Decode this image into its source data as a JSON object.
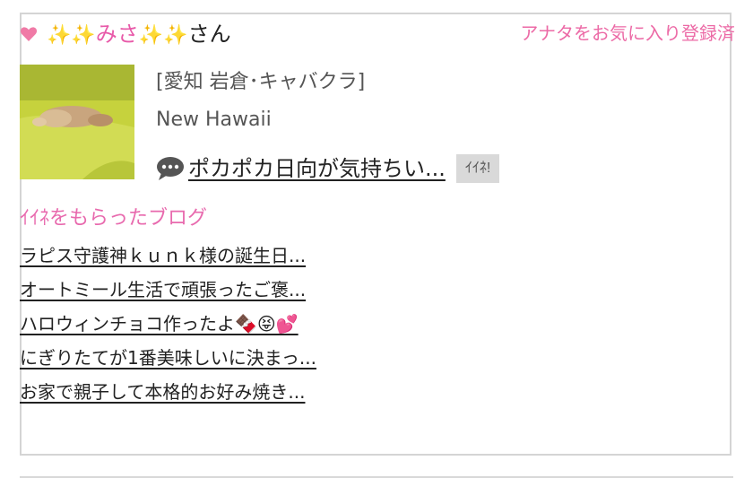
{
  "profile": {
    "name_prefix": "✨✨",
    "name_core": "みさ",
    "name_suffix_sparkles": "✨✨",
    "honorific": "さん",
    "favorite_status": "アナタをお気に入り登録済",
    "area": "[愛知 岩倉･キャバクラ]",
    "shop_name": "New Hawaii"
  },
  "post": {
    "title": "ポカポカ日向が気持ちい...",
    "like_label": "ｲｲﾈ!"
  },
  "liked_blogs": {
    "heading": "ｲｲﾈをもらったブログ",
    "items": [
      {
        "title": "ラピス守護神ｋｕｎｋ様の誕生日..."
      },
      {
        "title": "オートミール生活で頑張ったご褒..."
      },
      {
        "title": "ハロウィンチョコ作ったよ🍫😝💕"
      },
      {
        "title": "にぎりたてが1番美味しいに決まっ..."
      },
      {
        "title": "お家で親子して本格的お好み焼き..."
      }
    ]
  },
  "colors": {
    "accent_pink": "#ec6aa6",
    "heart": "#f07aa6",
    "border": "#d4d4d4",
    "like_button_bg": "#d9d9d9"
  },
  "icons": {
    "heart": "heart-icon",
    "comment": "speech-bubble-icon",
    "sparkle": "sparkles-icon"
  }
}
